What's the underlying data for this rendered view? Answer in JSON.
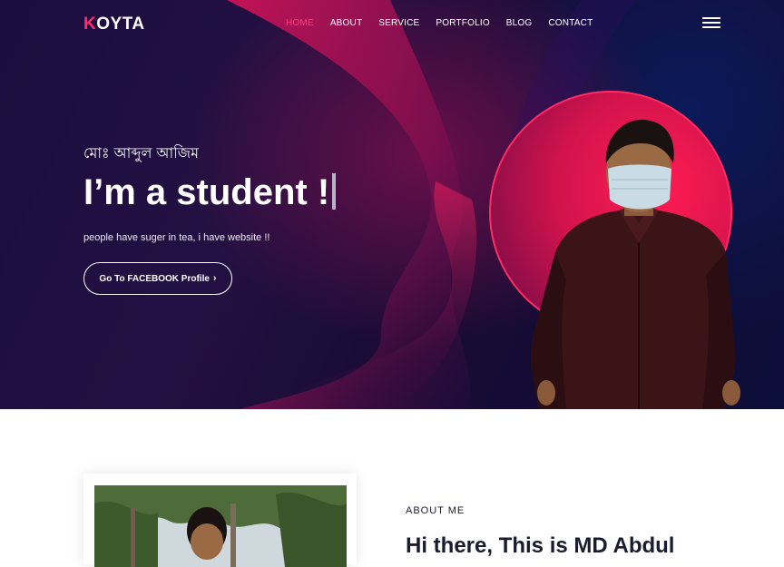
{
  "logo": {
    "k": "K",
    "rest": "OYTA"
  },
  "nav": {
    "items": [
      "HOME",
      "ABOUT",
      "SERVICE",
      "PORTFOLIO",
      "BLOG",
      "CONTACT"
    ],
    "active": "HOME"
  },
  "hero": {
    "subtitle": "মোঃ আব্দুল আজিম",
    "headline": "I’m a student !",
    "tagline": "people have suger in tea, i have website !!",
    "cta_label": "Go To FACEBOOK Profile",
    "cta_icon": "chevron-right-icon"
  },
  "about": {
    "label": "ABOUT ME",
    "title": "Hi there, This is MD Abdul"
  },
  "colors": {
    "accent": "#ff3d7f",
    "ring": "#d3134d",
    "hero_dark": "#1c0d3e"
  }
}
